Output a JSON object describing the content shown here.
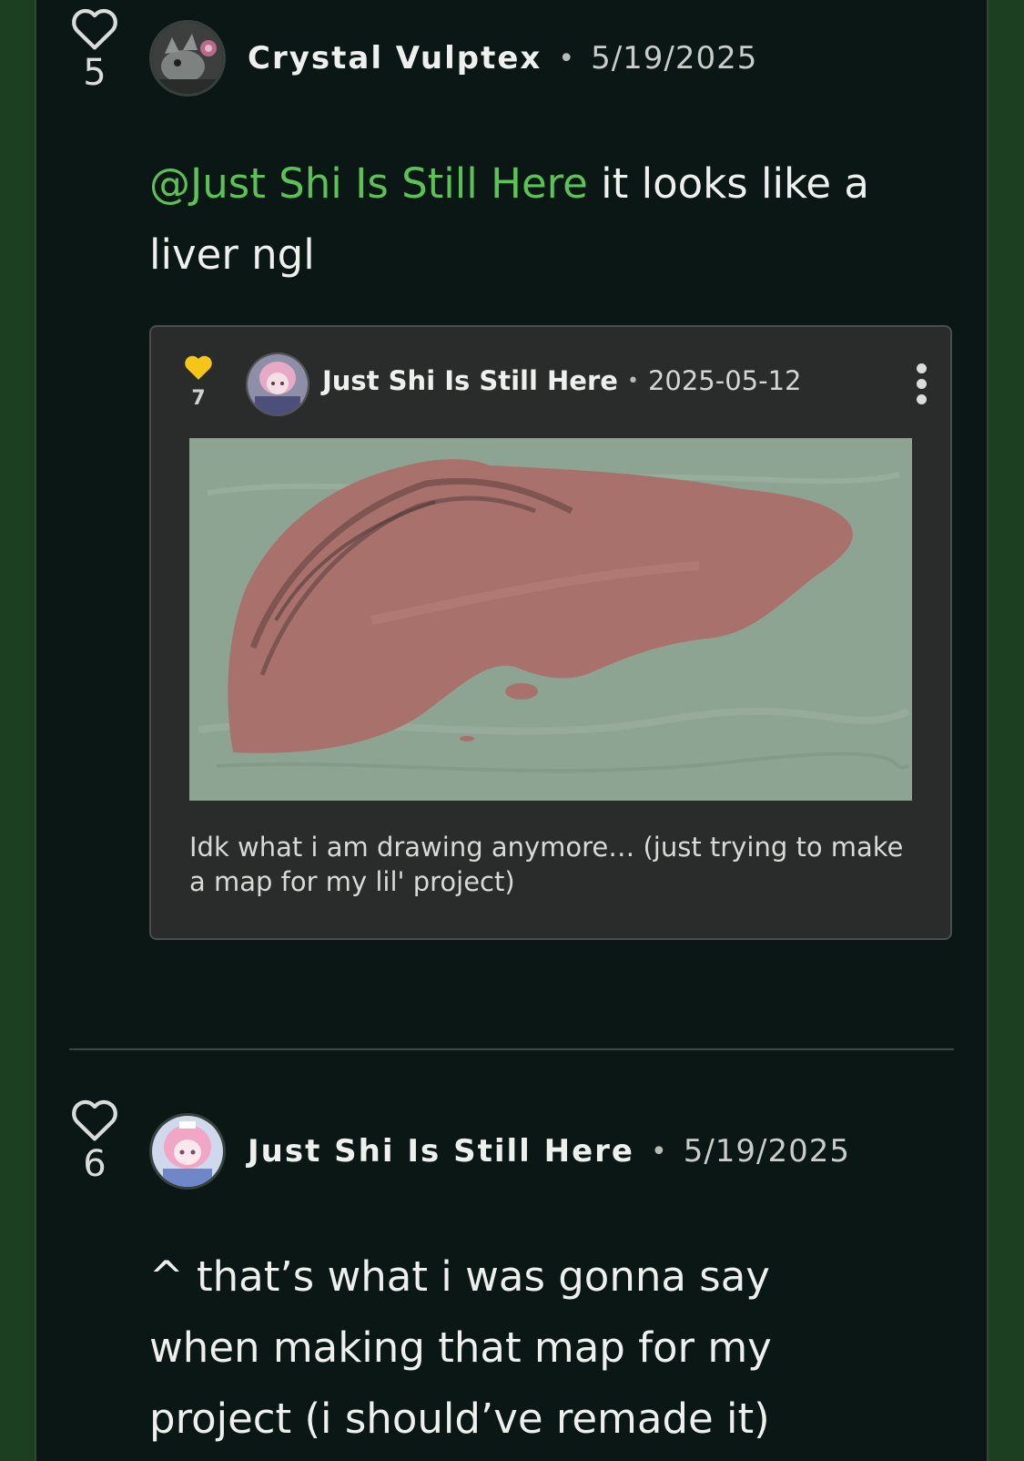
{
  "colors": {
    "page_background": "#1c3f22",
    "panel_background": "#0b1714",
    "mention": "#5cc157",
    "heart_filled": "#f5c518"
  },
  "comments": [
    {
      "likes": "5",
      "author": "Crystal Vulptex",
      "separator": "•",
      "date": "5/19/2025",
      "mention": "@Just Shi Is Still Here",
      "text": " it looks like a liver ngl",
      "embed": {
        "likes": "7",
        "author": "Just Shi Is Still Here",
        "separator": "•",
        "date": "2025-05-12",
        "caption": "Idk what i am drawing anymore… (just trying to make a map for my lil' project)",
        "menu_icon": "kebab-menu-icon"
      }
    },
    {
      "likes": "6",
      "author": "Just Shi Is Still Here",
      "separator": "•",
      "date": "5/19/2025",
      "text": "^ that’s what i was gonna say when making that map for my project (i should’ve remade it)"
    }
  ]
}
